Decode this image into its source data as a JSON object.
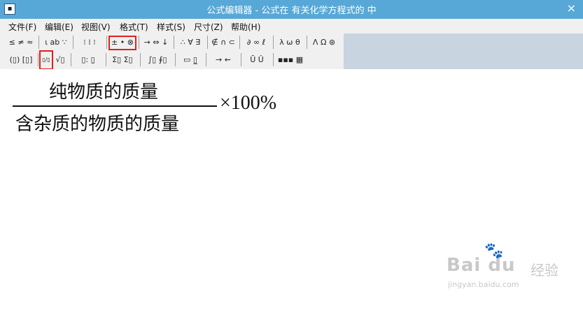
{
  "window": {
    "title": "公式编辑器 - 公式在 有关化学方程式的 中",
    "close_glyph": "×"
  },
  "menu": [
    "文件(F)",
    "编辑(E)",
    "视图(V)",
    "格式(T)",
    "样式(S)",
    "尺寸(Z)",
    "帮助(H)"
  ],
  "toolbar": {
    "row1": [
      "≤ ≠ ≈",
      "⍳ ab ∵",
      "⁝ ⁞ ⁝",
      "± • ⊗",
      "→ ⇔ ↓",
      "∴ ∀ ∃",
      "∉ ∩ ⊂",
      "∂ ∞ ℓ",
      "λ ω θ",
      "Λ Ω ⊛"
    ],
    "row2": [
      "(▯) [▯]",
      "▯/▯",
      "√▯",
      "▯: ▯̣",
      "Σ▯ Σ▯",
      "∫▯ ∮▯",
      "▭ ▯̲",
      "→ ⇜",
      "Ū Ǔ",
      "▪▪▪ ▦"
    ]
  },
  "equation": {
    "numerator": "纯物质的质量",
    "denominator": "含杂质的物质的质量",
    "multiplier": "×100%"
  },
  "watermark": {
    "logo": "Bai du",
    "paw": "🐾",
    "text": "经验",
    "url": "jingyan.baidu.com"
  },
  "colors": {
    "titlebar": "#57a8d6",
    "highlight": "#e0201c"
  }
}
